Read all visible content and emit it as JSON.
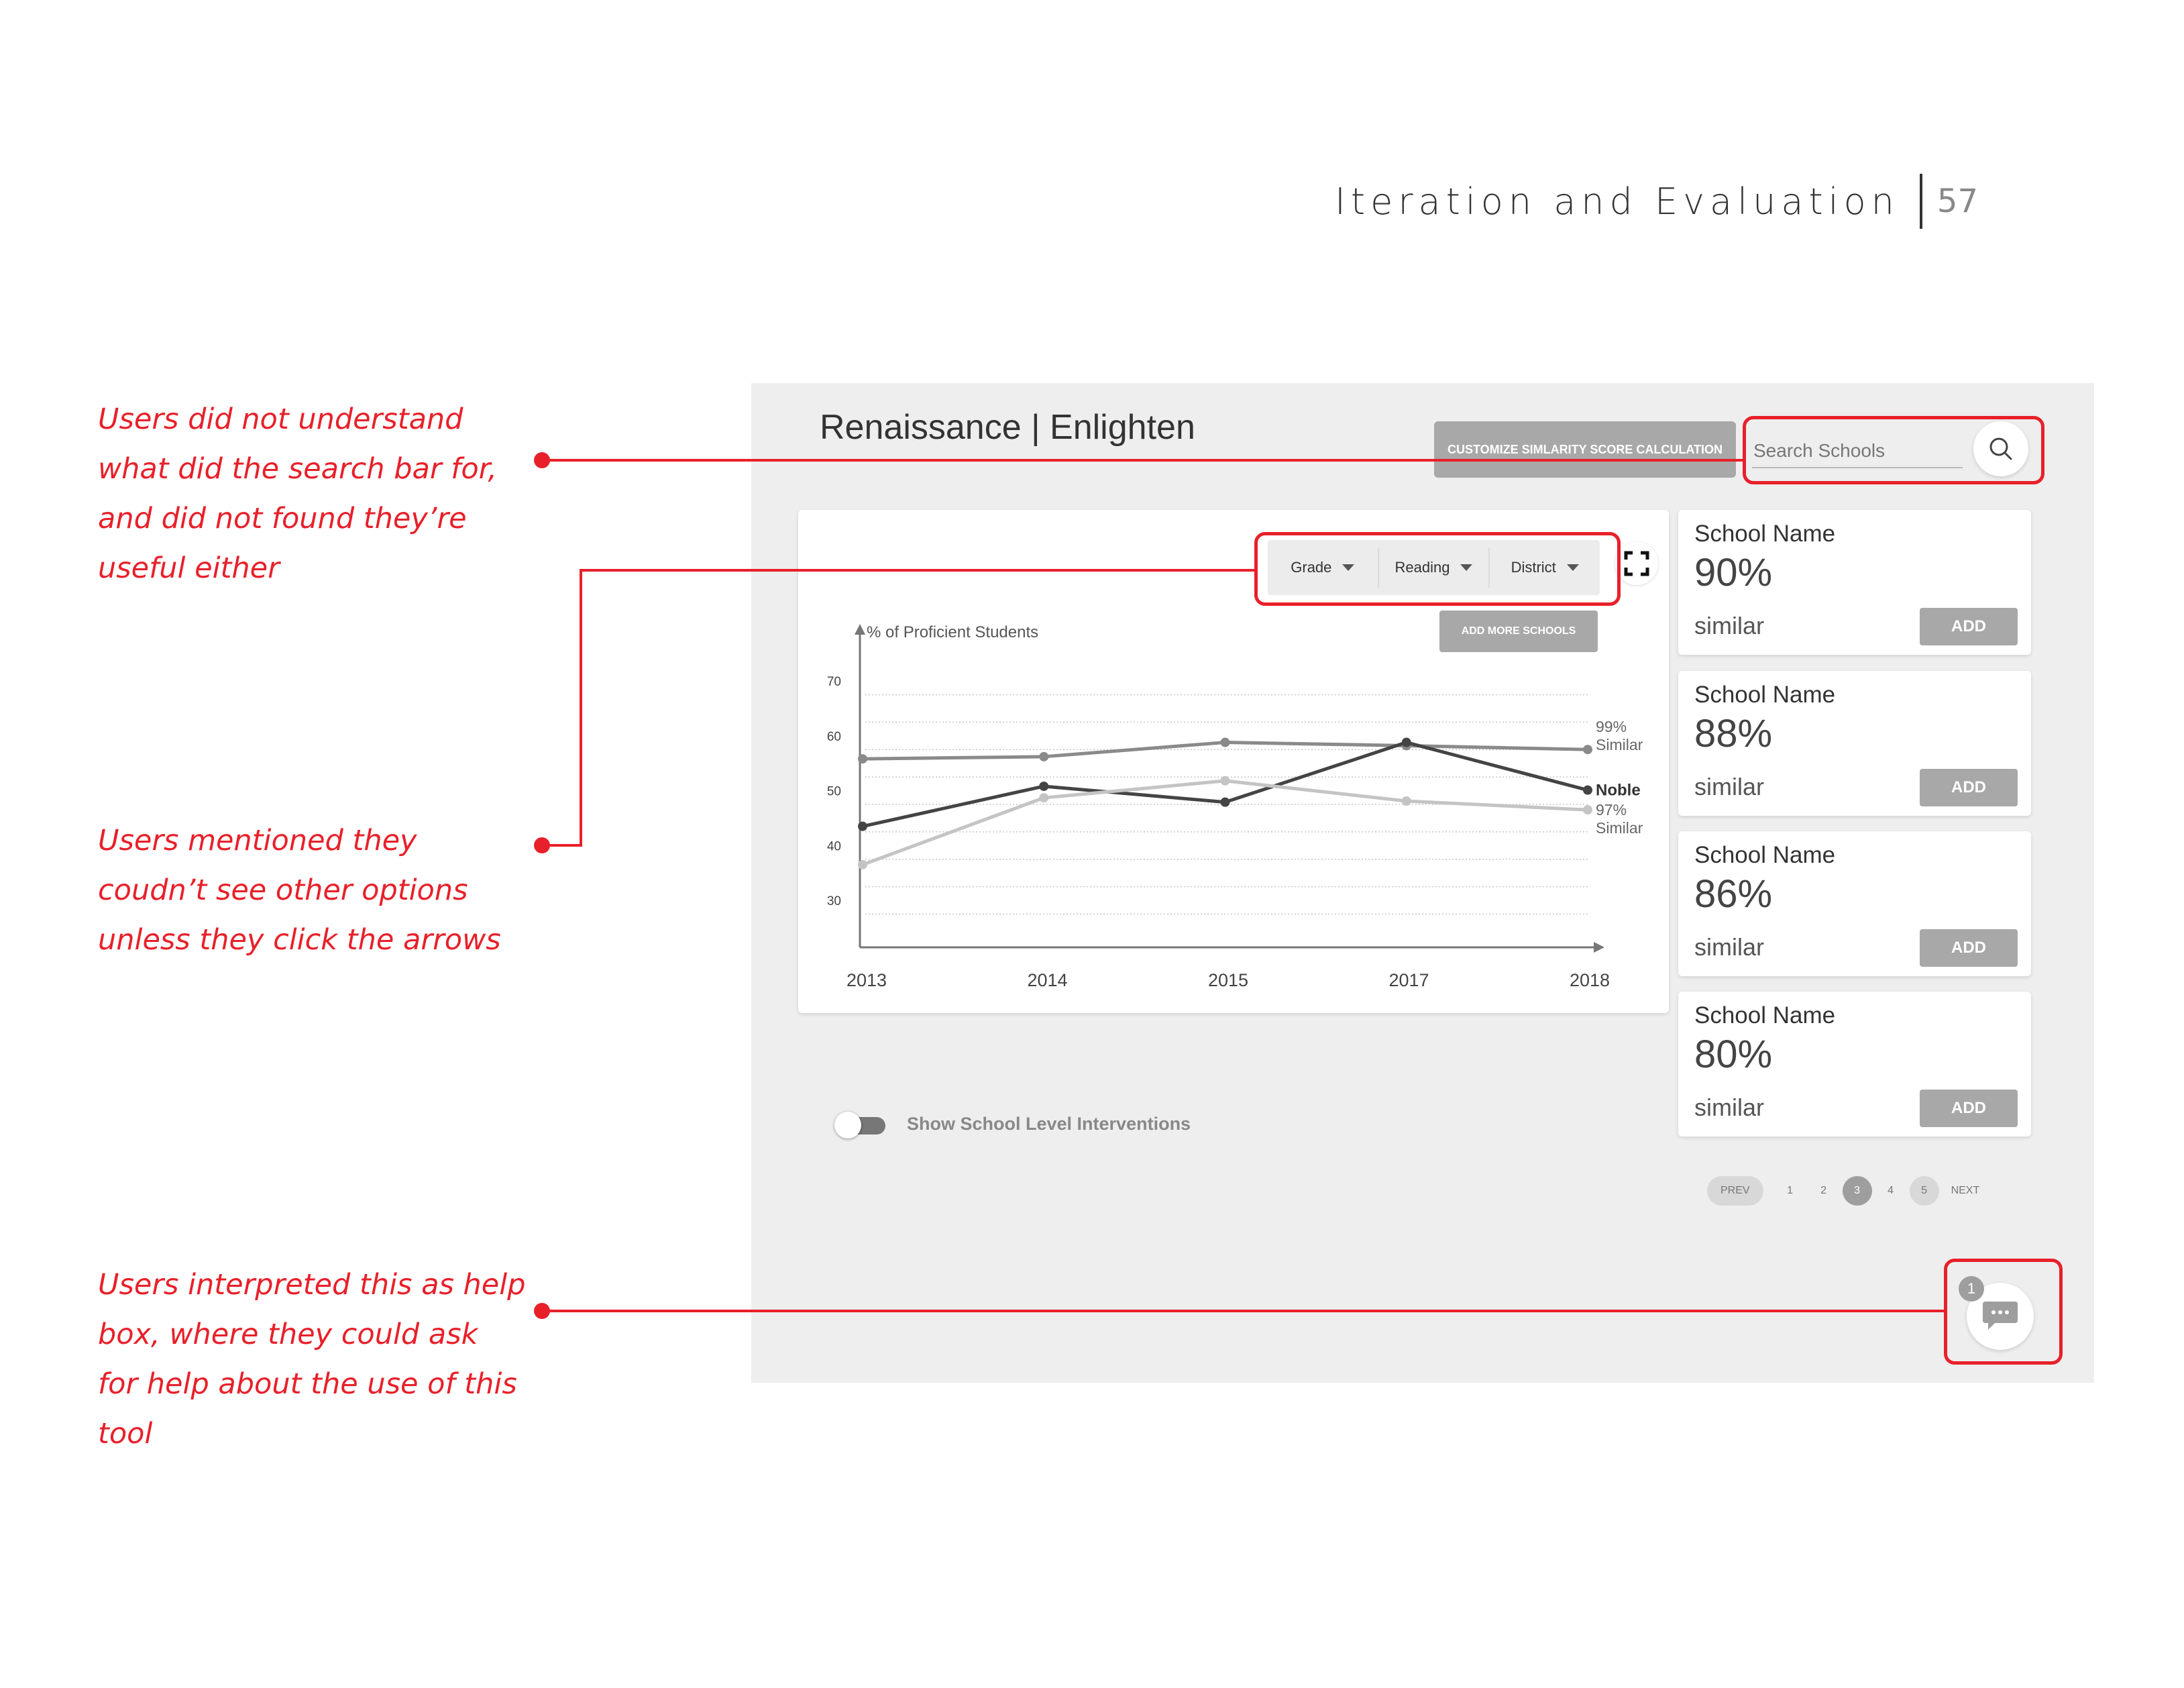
{
  "header": {
    "title": "Iteration and Evaluation",
    "page_number": "57"
  },
  "annotations": [
    {
      "lines": [
        "Users did not understand",
        "what did the search bar for,",
        "and did  not found they’re",
        "useful either"
      ]
    },
    {
      "lines": [
        "Users mentioned they",
        "coudn’t see other options",
        "unless they click the arrows"
      ]
    },
    {
      "lines": [
        "Users interpreted this as help",
        "box, where they could ask",
        "for help about the use of this",
        "tool"
      ]
    }
  ],
  "app": {
    "title": "Renaissance | Enlighten",
    "customize_label": "CUSTOMIZE SIMLARITY SCORE CALCULATION",
    "search_placeholder": "Search Schools",
    "filters": [
      "Grade",
      "Reading",
      "District"
    ],
    "add_more_label": "ADD MORE SCHOOLS",
    "toggle_label": "Show School Level Interventions",
    "toggle_on": false,
    "schools": [
      {
        "name": "School Name",
        "percent": "90%",
        "similar": "similar",
        "add": "ADD"
      },
      {
        "name": "School Name",
        "percent": "88%",
        "similar": "similar",
        "add": "ADD"
      },
      {
        "name": "School Name",
        "percent": "86%",
        "similar": "similar",
        "add": "ADD"
      },
      {
        "name": "School Name",
        "percent": "80%",
        "similar": "similar",
        "add": "ADD"
      }
    ],
    "pager": {
      "prev": "PREV",
      "pages": [
        "1",
        "2",
        "3",
        "4",
        "5"
      ],
      "active": "3",
      "next": "NEXT"
    },
    "chat_badge": "1",
    "icons": [
      "search-icon",
      "expand-icon",
      "chat-icon",
      "caret-down-icon"
    ]
  },
  "chart_data": {
    "type": "line",
    "ylabel": "% of Proficient Students",
    "y_ticks": [
      70,
      60,
      50,
      40,
      30
    ],
    "x": [
      "2013",
      "2014",
      "2015",
      "2017",
      "2018"
    ],
    "series": [
      {
        "name": "99% Similar",
        "label_lines": [
          "99%",
          "Similar"
        ],
        "color": "#8a8a8a",
        "values": [
          55.8,
          56.2,
          58.8,
          58.2,
          57.5
        ]
      },
      {
        "name": "Noble",
        "label_lines": [
          "Noble"
        ],
        "color": "#444444",
        "values": [
          43.5,
          50.8,
          47.9,
          58.8,
          50.1
        ]
      },
      {
        "name": "97% Similar",
        "label_lines": [
          "97%",
          "Similar"
        ],
        "color": "#c4c4c4",
        "values": [
          36.5,
          48.7,
          51.8,
          48.1,
          46.5
        ]
      }
    ]
  }
}
